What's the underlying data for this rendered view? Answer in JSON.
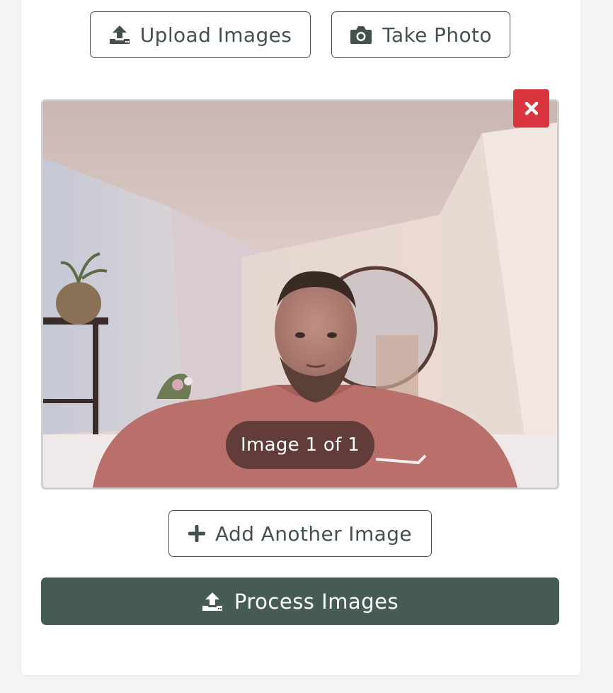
{
  "actions": {
    "upload_label": "Upload Images",
    "take_photo_label": "Take Photo",
    "add_another_label": "Add Another Image",
    "process_label": "Process Images"
  },
  "preview": {
    "counter_text": "Image 1 of 1"
  },
  "icons": {
    "upload": "upload-icon",
    "camera": "camera-icon",
    "remove": "close-icon",
    "add": "plus-icon"
  },
  "colors": {
    "primary": "#465a56",
    "outline": "#44524f",
    "danger": "#d9353f"
  }
}
